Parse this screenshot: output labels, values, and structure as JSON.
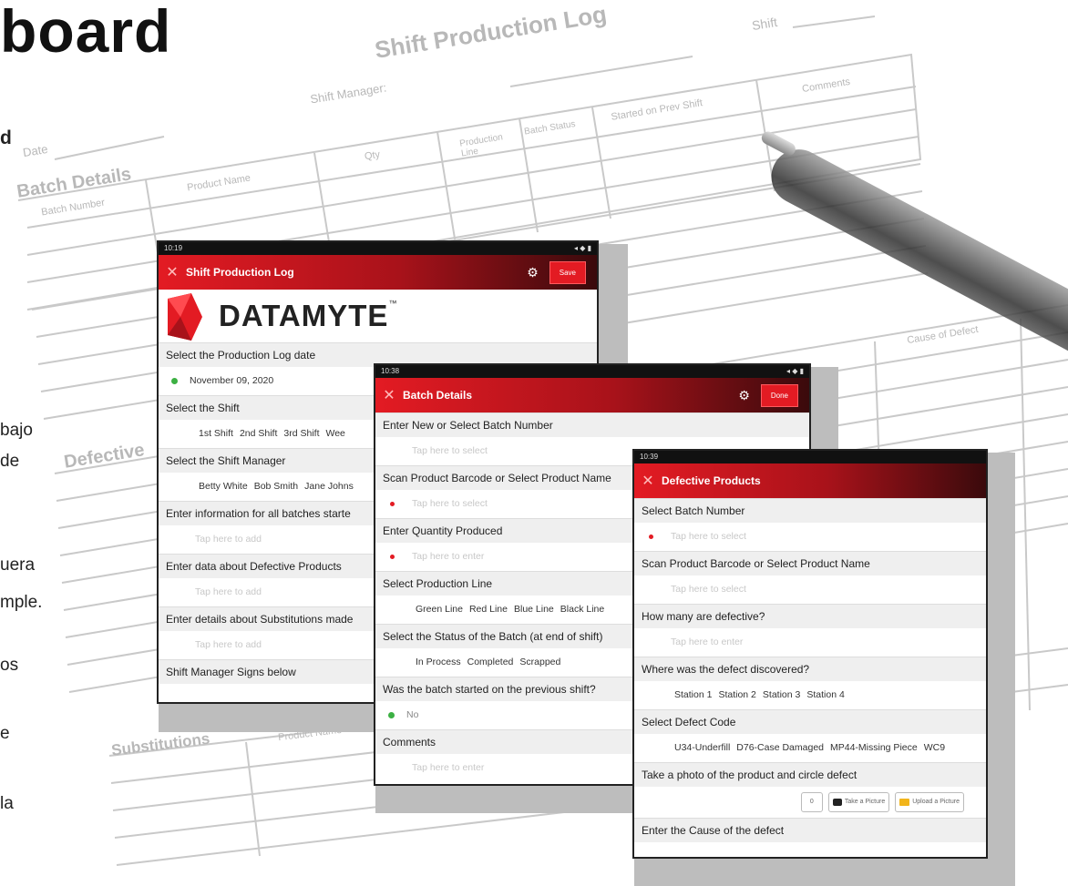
{
  "heading": "board",
  "side_texts": [
    "d",
    "bajo",
    "de",
    "uera",
    "mple.",
    "os",
    "e",
    "la"
  ],
  "paper": {
    "title": "Shift Production Log",
    "shift_label": "Shift",
    "manager_label": "Shift Manager:",
    "date_label": "Date",
    "batch_details": "Batch Details",
    "batch_number": "Batch Number",
    "product_name": "Product Name",
    "qty": "Qty",
    "production_line": "Production Line",
    "batch_status": "Batch Status",
    "started_prev": "Started on Prev Shift",
    "comments": "Comments",
    "defective": "Defective",
    "cause_of_defect": "Cause of Defect",
    "substitutions": "Substitutions",
    "sub_product": "Product Name"
  },
  "screen1": {
    "status_time": "10:19",
    "title": "Shift Production Log",
    "save_label": "Save",
    "logo_text": "DATAMYTE",
    "trademark": "™",
    "q_date": "Select the Production Log date",
    "a_date": "November 09, 2020",
    "q_shift": "Select the Shift",
    "shift_options": [
      "1st Shift",
      "2nd Shift",
      "3rd Shift",
      "Wee"
    ],
    "q_manager": "Select the Shift Manager",
    "manager_options": [
      "Betty White",
      "Bob Smith",
      "Jane Johns"
    ],
    "q_batches": "Enter information for all batches starte",
    "a_batches": "Tap here to add",
    "q_defective": "Enter data about Defective Products",
    "a_defective": "Tap here to add",
    "q_subs": "Enter details about Substitutions made",
    "a_subs": "Tap here to add",
    "q_sign": "Shift Manager Signs below"
  },
  "screen2": {
    "status_time": "10:38",
    "title": "Batch Details",
    "done_label": "Done",
    "q_batch": "Enter New or Select Batch Number",
    "a_batch": "Tap here to select",
    "q_scan": "Scan Product Barcode or Select Product Name",
    "a_scan": "Tap here to select",
    "q_qty": "Enter Quantity Produced",
    "a_qty": "Tap here to enter",
    "q_line": "Select Production Line",
    "line_options": [
      "Green Line",
      "Red Line",
      "Blue Line",
      "Black Line"
    ],
    "q_status": "Select the Status of the Batch (at end of shift)",
    "status_options": [
      "In Process",
      "Completed",
      "Scrapped"
    ],
    "q_prev": "Was the batch started on the previous shift?",
    "a_prev": "No",
    "q_comments": "Comments",
    "a_comments": "Tap here to enter"
  },
  "screen3": {
    "status_time": "10:39",
    "title": "Defective Products",
    "q_batch": "Select Batch Number",
    "a_batch": "Tap here to select",
    "q_scan": "Scan Product Barcode or Select Product Name",
    "a_scan": "Tap here to select",
    "q_count": "How many are defective?",
    "a_count": "Tap here to enter",
    "q_where": "Where was the defect discovered?",
    "station_options": [
      "Station 1",
      "Station 2",
      "Station 3",
      "Station 4"
    ],
    "q_code": "Select Defect Code",
    "code_options": [
      "U34-Underfill",
      "D76-Case Damaged",
      "MP44-Missing Piece",
      "WC9"
    ],
    "q_photo": "Take a photo of the product and circle defect",
    "photo_count": "0",
    "take_picture": "Take a Picture",
    "upload_picture": "Upload a Picture",
    "q_cause": "Enter the Cause of the defect"
  },
  "colors": {
    "brand_red": "#e31b23",
    "dark_red": "#3a0a0c",
    "green": "#3cb043"
  }
}
